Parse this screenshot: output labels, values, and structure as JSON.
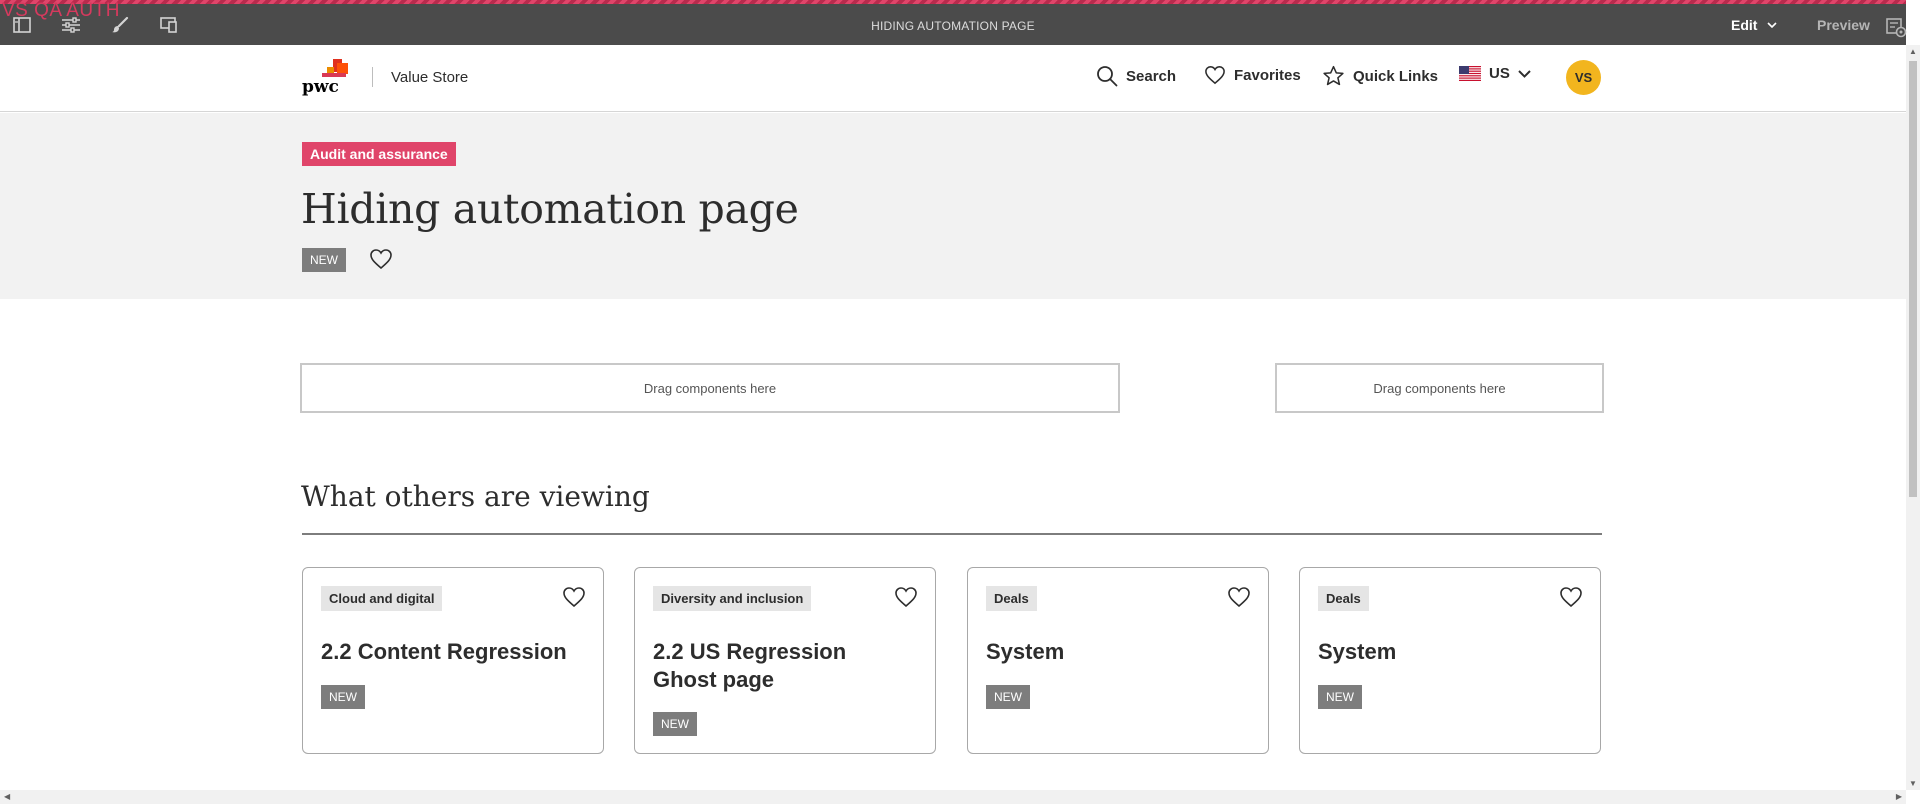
{
  "editor": {
    "env_label": "VS QA AUTH",
    "page_title": "HIDING AUTOMATION PAGE",
    "mode": "Edit",
    "preview": "Preview",
    "accent": "#d63a5e"
  },
  "header": {
    "logo_text": "pwc",
    "site_name": "Value Store",
    "nav": {
      "search": "Search",
      "favorites": "Favorites",
      "quick_links": "Quick Links",
      "region": "US"
    },
    "avatar_initials": "VS",
    "avatar_color": "#f2b51e"
  },
  "hero": {
    "category": "Audit and assurance",
    "category_color": "#e0456a",
    "title": "Hiding automation page",
    "badge": "NEW"
  },
  "dropzones": {
    "left": "Drag components here",
    "right": "Drag components here"
  },
  "others": {
    "heading": "What others are viewing",
    "cards": [
      {
        "tag": "Cloud and digital",
        "title": "2.2 Content Regression",
        "badge": "NEW"
      },
      {
        "tag": "Diversity and inclusion",
        "title": "2.2 US Regression Ghost page",
        "badge": "NEW"
      },
      {
        "tag": "Deals",
        "title": "System",
        "badge": "NEW"
      },
      {
        "tag": "Deals",
        "title": "System",
        "badge": "NEW"
      }
    ]
  }
}
